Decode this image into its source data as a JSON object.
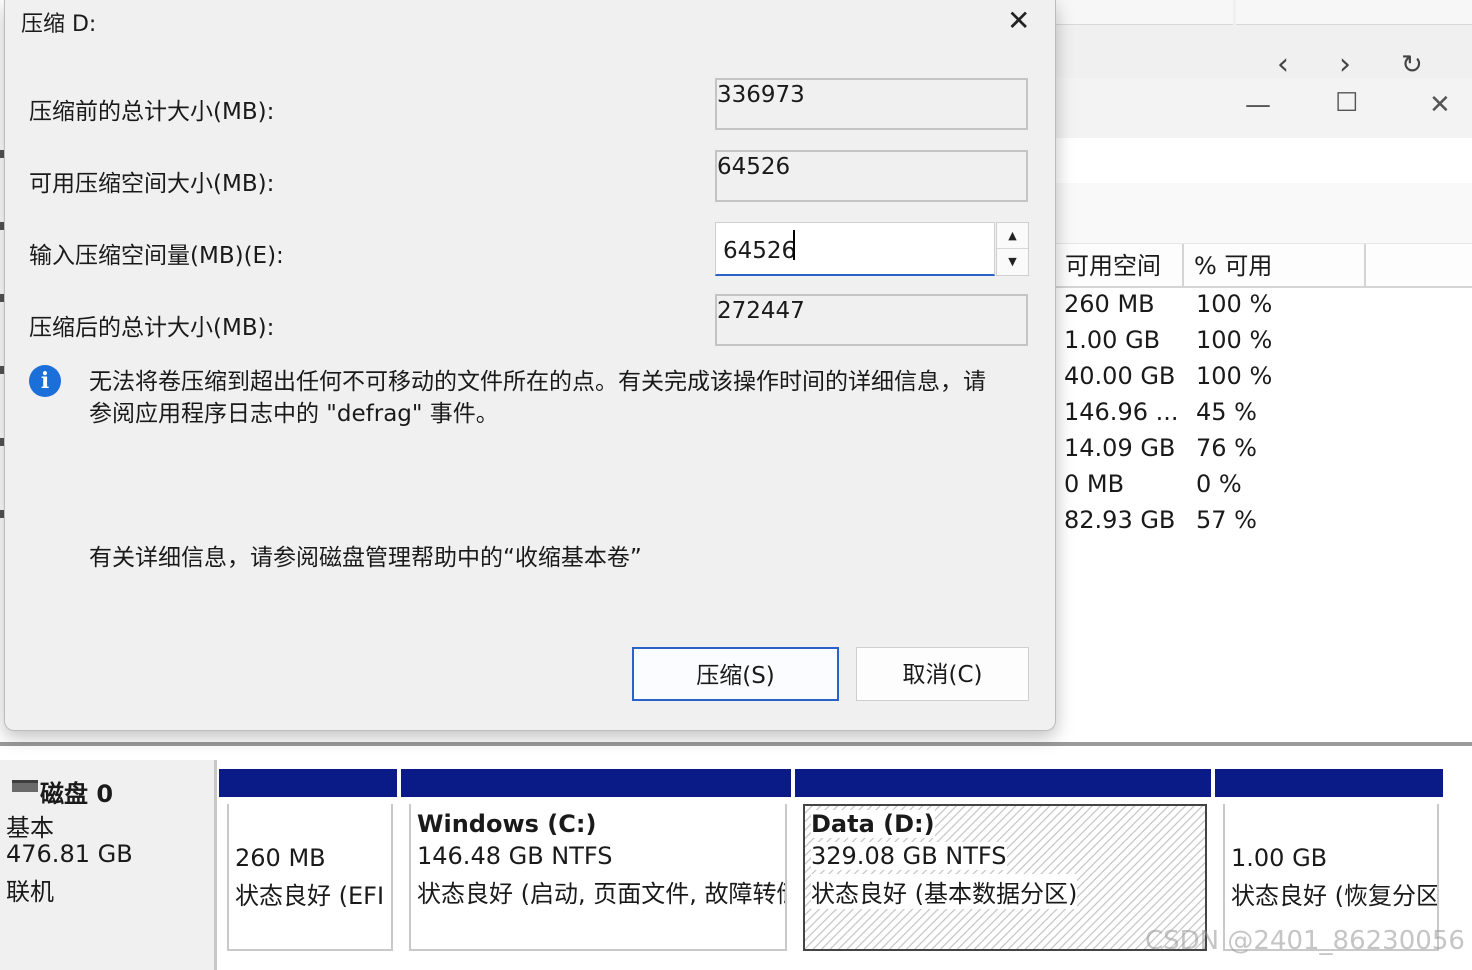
{
  "dialog": {
    "title": "压缩 D:",
    "close_glyph": "✕",
    "fields": {
      "total_before": {
        "label": "压缩前的总计大小(MB):",
        "value": "336973"
      },
      "available": {
        "label": "可用压缩空间大小(MB):",
        "value": "64526"
      },
      "amount": {
        "label": "输入压缩空间量(MB)(E):",
        "value": "64526"
      },
      "total_after": {
        "label": "压缩后的总计大小(MB):",
        "value": "272447"
      }
    },
    "info_icon_glyph": "i",
    "info_line1": "无法将卷压缩到超出任何不可移动的文件所在的点。有关完成该操作时间的详细信息，请",
    "info_line2": "参阅应用程序日志中的 \"defrag\" 事件。",
    "help_text": "有关详细信息，请参阅磁盘管理帮助中的“收缩基本卷”",
    "shrink_button": "压缩(S)",
    "cancel_button": "取消(C)"
  },
  "window": {
    "nav_back": "‹",
    "nav_forward": "›",
    "refresh": "↻",
    "minimize": "—",
    "maximize": "☐",
    "close": "✕"
  },
  "volume_table": {
    "headers": [
      "可用空间",
      "% 可用"
    ],
    "rows": [
      [
        "260 MB",
        "100 %"
      ],
      [
        "1.00 GB",
        "100 %"
      ],
      [
        "40.00 GB",
        "100 %"
      ],
      [
        "146.96 ...",
        "45 %"
      ],
      [
        "14.09 GB",
        "76 %"
      ],
      [
        "0 MB",
        "0 %"
      ],
      [
        "82.93 GB",
        "57 %"
      ]
    ]
  },
  "disk": {
    "name": "磁盘 0",
    "type": "基本",
    "size": "476.81 GB",
    "status": "联机",
    "partitions": [
      {
        "name": "",
        "size": "260 MB",
        "status": "状态良好 (EFI 系统分区)"
      },
      {
        "name": "Windows  (C:)",
        "size": "146.48 GB NTFS",
        "status": "状态良好 (启动, 页面文件, 故障转储, 基本数据分区)"
      },
      {
        "name": "Data  (D:)",
        "size": "329.08 GB NTFS",
        "status": "状态良好 (基本数据分区)"
      },
      {
        "name": "",
        "size": "1.00 GB",
        "status": "状态良好 (恢复分区)"
      }
    ]
  },
  "watermark": "CSDN @2401_86230056"
}
